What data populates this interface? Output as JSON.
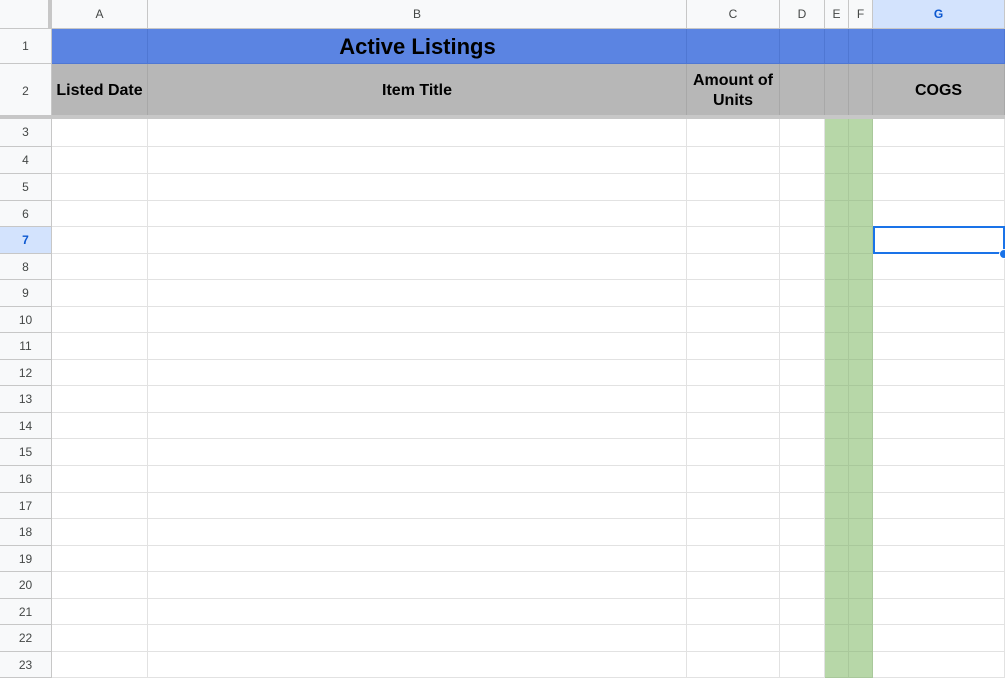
{
  "columns": [
    "A",
    "B",
    "C",
    "D",
    "E",
    "F",
    "G"
  ],
  "rows": [
    "1",
    "2",
    "3",
    "4",
    "5",
    "6",
    "7",
    "8",
    "9",
    "10",
    "11",
    "12",
    "13",
    "14",
    "15",
    "16",
    "17",
    "18",
    "19",
    "20",
    "21",
    "22",
    "23"
  ],
  "sheet": {
    "title": "Active Listings",
    "headers": {
      "A": "Listed Date",
      "B": "Item Title",
      "C": "Amount of Units",
      "D": "",
      "E": "",
      "F": "",
      "G": "COGS"
    }
  },
  "selection": {
    "cell": "G7",
    "column": "G",
    "row": "7"
  },
  "colors": {
    "title_fill": "#5b84e2",
    "header_fill": "#b7b7b7",
    "highlight_column_fill": "#b7d7a8",
    "selection": "#1a73e8"
  }
}
